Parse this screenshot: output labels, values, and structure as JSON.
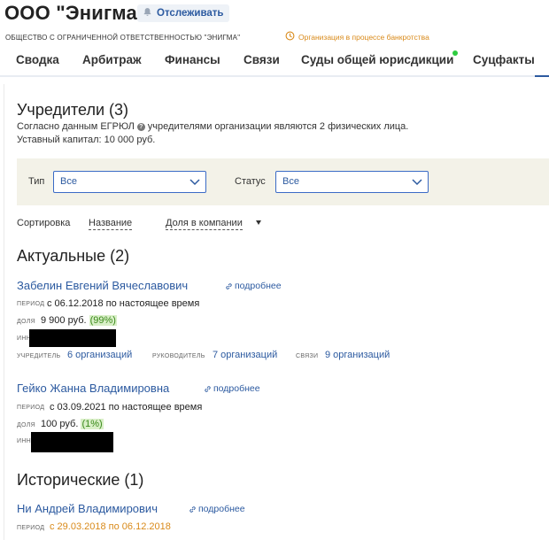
{
  "header": {
    "title": "ООО \"Энигма\"",
    "follow_label": "Отслеживать",
    "full_name": "ОБЩЕСТВО С ОГРАНИЧЕННОЙ ОТВЕТСТВЕННОСТЬЮ \"ЭНИГМА\"",
    "bankruptcy_status": "Организация в процессе банкротства",
    "colors": {
      "accent": "#2c5aa0",
      "warning": "#d98a1a",
      "green_dot": "#2ecc40"
    }
  },
  "tabs": [
    {
      "label": "Сводка"
    },
    {
      "label": "Арбитраж"
    },
    {
      "label": "Финансы"
    },
    {
      "label": "Связи"
    },
    {
      "label": "Суды общей юрисдикции",
      "has_indicator": true
    },
    {
      "label": "Суцфакты"
    }
  ],
  "founders": {
    "title": "Учредители (3)",
    "note_prefix": "Согласно данным ЕГРЮЛ",
    "note_suffix": "учредителями организации являются 2 физических лица.",
    "capital": "Уставный капитал: 10 000 руб."
  },
  "filters": {
    "type_label": "Тип",
    "type_value": "Все",
    "status_label": "Статус",
    "status_value": "Все"
  },
  "sort": {
    "label": "Сортировка",
    "by_name": "Название",
    "by_share": "Доля в компании"
  },
  "actual": {
    "title": "Актуальные (2)",
    "persons": [
      {
        "name": "Забелин Евгений Вячеславович",
        "more": "подробнее",
        "period_label": "ПЕРИОД",
        "period": "с 06.12.2018 по настоящее время",
        "share_label": "ДОЛЯ",
        "share": "9 900 руб.",
        "share_pct": "(99%)",
        "inn_label": "ИНН",
        "founder_label": "УЧРЕДИТЕЛЬ",
        "founder_value": "6 организаций",
        "head_label": "РУКОВОДИТЕЛЬ",
        "head_value": "7 организаций",
        "links_label": "СВЯЗИ",
        "links_value": "9 организаций"
      },
      {
        "name": "Гейко Жанна Владимировна",
        "more": "подробнее",
        "period_label": "ПЕРИОД",
        "period": "с 03.09.2021 по настоящее время",
        "share_label": "ДОЛЯ",
        "share": "100 руб.",
        "share_pct": "(1%)",
        "inn_label": "ИНН"
      }
    ]
  },
  "historical": {
    "title": "Исторические (1)",
    "persons": [
      {
        "name": "Ни Андрей Владимирович",
        "more": "подробнее",
        "period_label": "ПЕРИОД",
        "period": "с 29.03.2018 по 06.12.2018"
      }
    ]
  }
}
